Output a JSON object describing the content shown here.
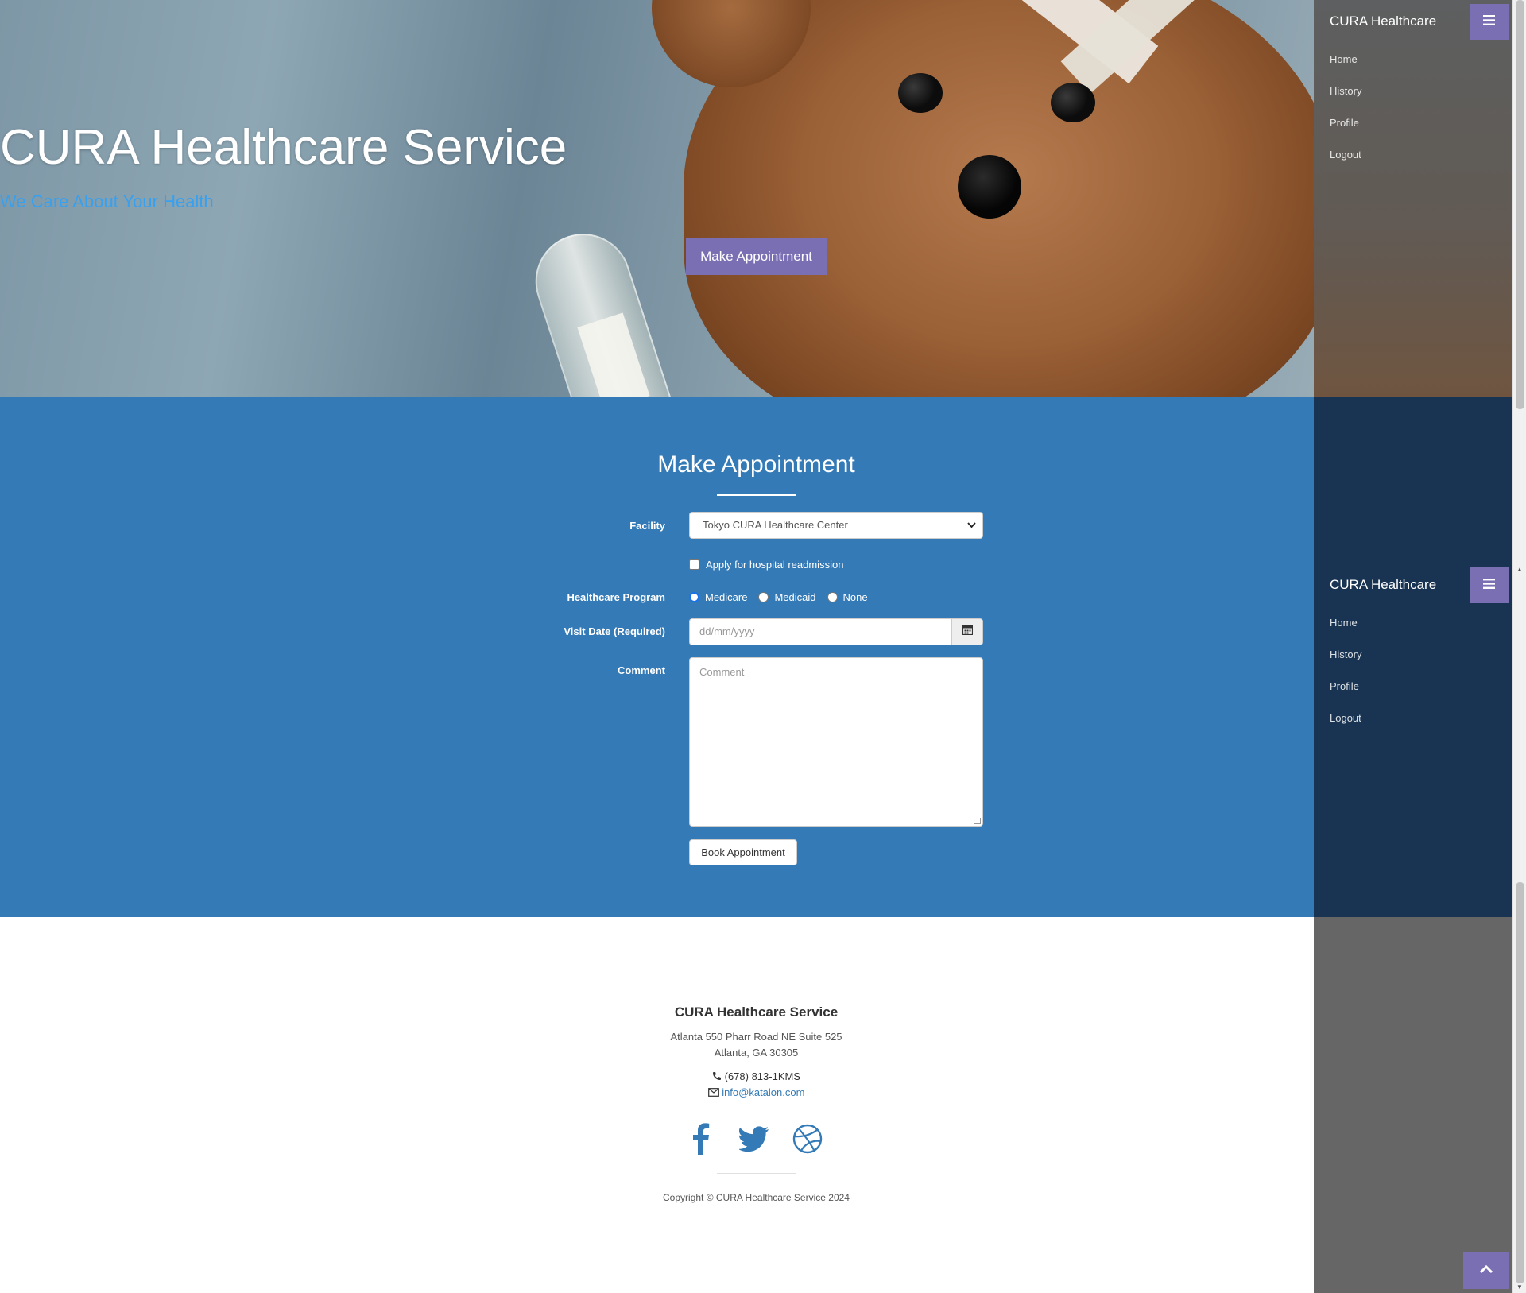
{
  "hero": {
    "title": "CURA Healthcare Service",
    "subtitle": "We Care About Your Health",
    "cta_label": "Make Appointment"
  },
  "appointment": {
    "title": "Make Appointment",
    "facility": {
      "label": "Facility",
      "selected": "Tokyo CURA Healthcare Center"
    },
    "readmission": {
      "label": "Apply for hospital readmission",
      "checked": false
    },
    "program": {
      "label": "Healthcare Program",
      "options": [
        "Medicare",
        "Medicaid",
        "None"
      ],
      "selected": "Medicare"
    },
    "visit_date": {
      "label": "Visit Date (Required)",
      "placeholder": "dd/mm/yyyy"
    },
    "comment": {
      "label": "Comment",
      "placeholder": "Comment"
    },
    "submit_label": "Book Appointment"
  },
  "footer": {
    "name": "CURA Healthcare Service",
    "address_line1": "Atlanta 550 Pharr Road NE Suite 525",
    "address_line2": "Atlanta, GA 30305",
    "phone": "(678) 813-1KMS",
    "email": "info@katalon.com",
    "copyright": "Copyright © CURA Healthcare Service 2024",
    "social_icons": [
      "facebook-icon",
      "twitter-icon",
      "dribbble-icon"
    ]
  },
  "sidebar": {
    "brand": "CURA Healthcare",
    "items": [
      {
        "label": "Home"
      },
      {
        "label": "History"
      },
      {
        "label": "Profile"
      },
      {
        "label": "Logout"
      }
    ]
  },
  "colors": {
    "primary": "#337ab7",
    "accent": "#7b6fb3",
    "subtitle": "#39a0ee",
    "sidebar_dark": "#183452"
  }
}
